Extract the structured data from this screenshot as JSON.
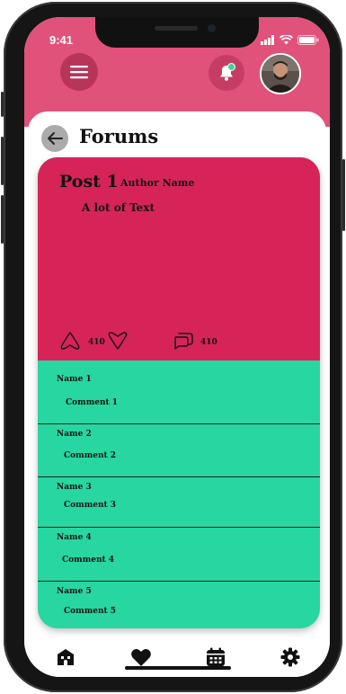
{
  "status_bar": {
    "time": "9:41"
  },
  "header": {
    "menu_icon": "hamburger-menu-icon",
    "notification_icon": "bell-icon",
    "avatar": "user-avatar"
  },
  "page": {
    "title": "Forums",
    "back_icon": "arrow-left-icon"
  },
  "post": {
    "title": "Post 1",
    "author": "Author Name",
    "text": "A lot of Text",
    "upvotes": "410",
    "comments_count": "410"
  },
  "comments": [
    {
      "name": "Name 1",
      "text": "Comment 1"
    },
    {
      "name": "Name 2",
      "text": "Comment 2"
    },
    {
      "name": "Name 3",
      "text": "Comment 3"
    },
    {
      "name": "Name 4",
      "text": "Comment 4"
    },
    {
      "name": "Name 5",
      "text": "Comment 5"
    }
  ],
  "tabbar": {
    "items": [
      {
        "icon": "home-icon"
      },
      {
        "icon": "heart-icon"
      },
      {
        "icon": "calendar-icon"
      },
      {
        "icon": "gear-icon"
      }
    ]
  },
  "colors": {
    "header": "#e0527a",
    "post": "#d72458",
    "comments": "#27d6a0",
    "notification_dot": "#3cd69b"
  }
}
